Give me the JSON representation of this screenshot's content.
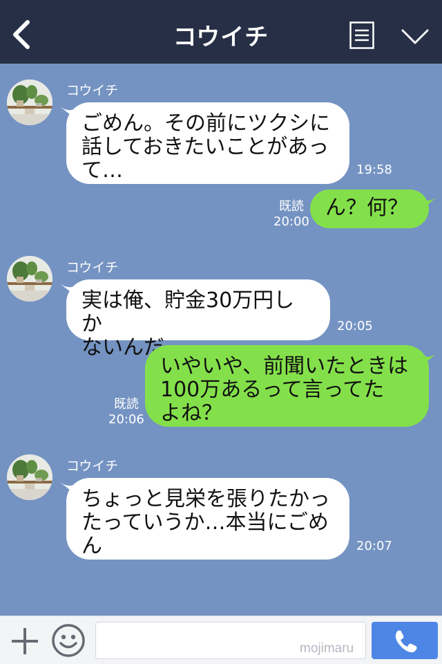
{
  "header": {
    "title": "コウイチ"
  },
  "messages": [
    {
      "direction": "in",
      "sender": "コウイチ",
      "lines": [
        "ごめん。その前にツクシに",
        "話しておきたいことがあっ",
        "て…"
      ],
      "time": "19:58"
    },
    {
      "direction": "out",
      "lines": [
        "ん？何？"
      ],
      "read": "既読",
      "time": "20:00"
    },
    {
      "direction": "in",
      "sender": "コウイチ",
      "lines": [
        "実は俺、貯金30万円しか",
        "ないんだ"
      ],
      "time": "20:05"
    },
    {
      "direction": "out",
      "lines": [
        "いやいや、前聞いたときは",
        "100万あるって言ってた",
        "よね？"
      ],
      "read": "既読",
      "time": "20:06"
    },
    {
      "direction": "in",
      "sender": "コウイチ",
      "lines": [
        "ちょっと見栄を張りたかっ",
        "たっていうか…本当にごめ",
        "ん"
      ],
      "time": "20:07"
    }
  ],
  "footer": {
    "watermark": "mojimaru"
  },
  "colors": {
    "header_bg": "#262f45",
    "chat_bg": "#7493c2",
    "outgoing_bubble": "#84e04a",
    "incoming_bubble": "#ffffff",
    "call_button": "#4e86e6"
  }
}
